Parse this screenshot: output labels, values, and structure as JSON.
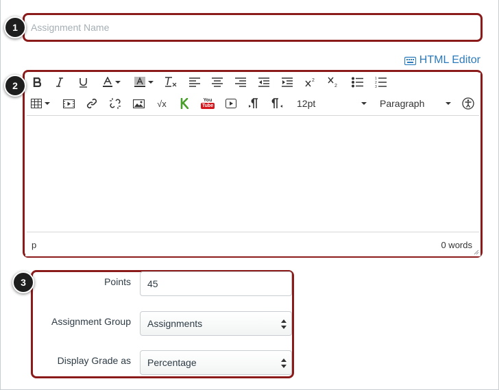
{
  "assignment": {
    "name_value": "",
    "name_placeholder": "Assignment Name"
  },
  "html_editor_link": "HTML Editor",
  "toolbar": {
    "row1": [
      "bold-icon",
      "italic-icon",
      "underline-icon",
      "text-color-icon",
      "background-color-icon",
      "clear-formatting-icon",
      "align-left-icon",
      "align-center-icon",
      "align-right-icon",
      "outdent-icon",
      "indent-icon",
      "superscript-icon",
      "subscript-icon",
      "bullet-list-icon",
      "numbered-list-icon"
    ],
    "row2": [
      "table-icon",
      "media-icon",
      "link-icon",
      "unlink-icon",
      "image-icon",
      "equation-icon",
      "kaltura-icon",
      "youtube-icon",
      "video-icon",
      "ltr-icon",
      "rtl-icon",
      "font-size-select",
      "paragraph-select",
      "accessibility-icon"
    ],
    "font_size": "12pt",
    "block_format": "Paragraph",
    "youtube_top": "You",
    "youtube_bottom": "Tube",
    "equation_glyph": "√x"
  },
  "editor": {
    "status_path": "p",
    "word_count": "0 words"
  },
  "form": {
    "points_label": "Points",
    "points_value": "45",
    "group_label": "Assignment Group",
    "group_value": "Assignments",
    "display_label": "Display Grade as",
    "display_value": "Percentage"
  },
  "callouts": [
    "1",
    "2",
    "3"
  ],
  "colors": {
    "outline": "#8b1a1a",
    "link": "#2b7abc",
    "text": "#2d3b45"
  }
}
